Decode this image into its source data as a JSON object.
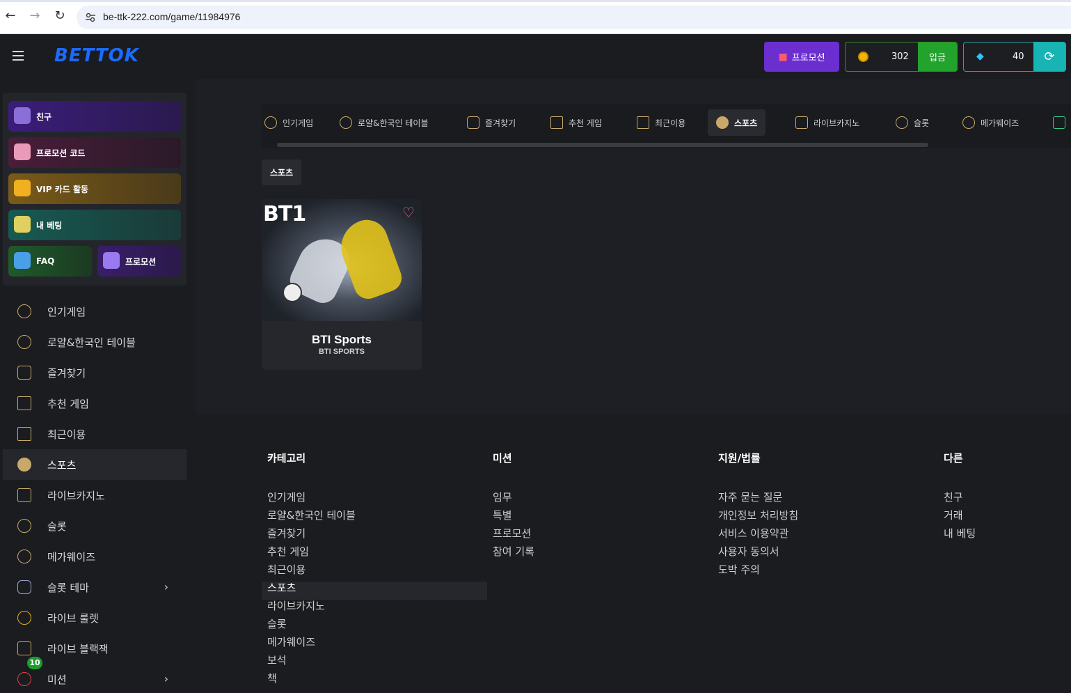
{
  "browser": {
    "url": "be-ttk-222.com/game/11984976"
  },
  "header": {
    "logo": "BETTOK",
    "promo_label": "프로모션",
    "coin_balance": "302",
    "deposit_label": "입금",
    "gem_balance": "40"
  },
  "promo_panel": {
    "items": [
      {
        "label": "친구",
        "color": "#3b1d6e"
      },
      {
        "label": "프로모션 코드",
        "color": "#3a1a2e"
      },
      {
        "label": "VIP 카드 활동",
        "color": "#6e5220"
      },
      {
        "label": "내 베팅",
        "color": "#145650"
      },
      {
        "label": "FAQ",
        "color": "#1f5a2a"
      },
      {
        "label": "프로모션",
        "color": "#3a1d6a"
      }
    ]
  },
  "sidebar": {
    "items": [
      {
        "label": "인기게임"
      },
      {
        "label": "로얄&한국인 테이블"
      },
      {
        "label": "즐겨찾기"
      },
      {
        "label": "추천 게임"
      },
      {
        "label": "최근이용"
      },
      {
        "label": "스포츠"
      },
      {
        "label": "라이브카지노"
      },
      {
        "label": "슬롯"
      },
      {
        "label": "메가웨이즈"
      },
      {
        "label": "슬롯 테마"
      },
      {
        "label": "라이브 룰렛"
      },
      {
        "label": "라이브 블랙잭"
      },
      {
        "label": "미션"
      }
    ],
    "mission_badge": "10"
  },
  "categories": {
    "tabs": [
      {
        "label": "인기게임"
      },
      {
        "label": "로얄&한국인 테이블"
      },
      {
        "label": "즐겨찾기"
      },
      {
        "label": "추천 게임"
      },
      {
        "label": "최근이용"
      },
      {
        "label": "스포츠"
      },
      {
        "label": "라이브카지노"
      },
      {
        "label": "슬롯"
      },
      {
        "label": "메가웨이즈"
      }
    ]
  },
  "breadcrumb": "스포츠",
  "game": {
    "thumb_text": "BT1",
    "title": "BTI Sports",
    "provider": "BTI SPORTS"
  },
  "footer": {
    "category": {
      "title": "카테고리",
      "links": [
        "인기게임",
        "로얄&한국인 테이블",
        "즐겨찾기",
        "추천 게임",
        "최근이용",
        "스포츠",
        "라이브카지노",
        "슬롯",
        "메가웨이즈",
        "보석",
        "책"
      ]
    },
    "mission": {
      "title": "미션",
      "links": [
        "임무",
        "특별",
        "프로모션",
        "참여 기록"
      ]
    },
    "support": {
      "title": "지원/법률",
      "links": [
        "자주 묻는 질문",
        "개인정보 처리방침",
        "서비스 이용약관",
        "사용자 동의서",
        "도박 주의"
      ]
    },
    "other": {
      "title": "다른",
      "links": [
        "친구",
        "거래",
        "내 베팅"
      ]
    }
  }
}
